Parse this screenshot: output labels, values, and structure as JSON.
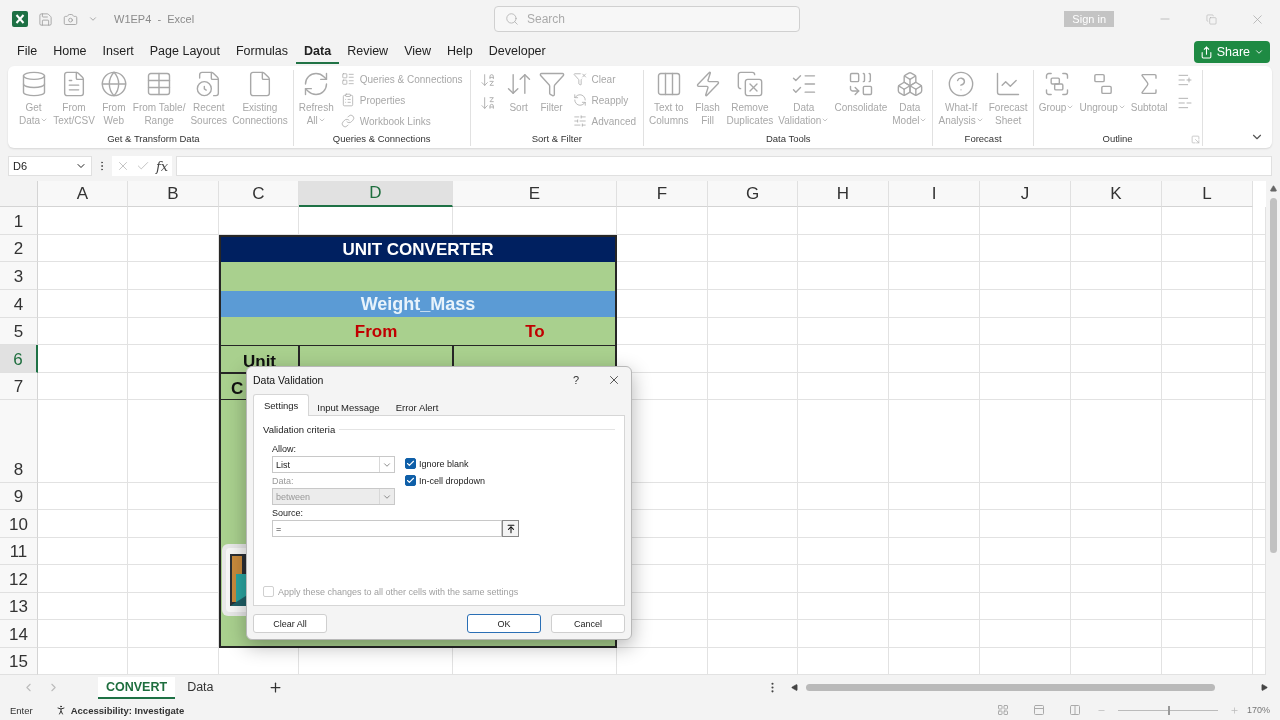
{
  "title_bar": {
    "title": "W1EP4  -  Excel",
    "search_placeholder": "Search",
    "sign_in": "Sign in"
  },
  "menu": [
    {
      "label": "File",
      "selected": false
    },
    {
      "label": "Home",
      "selected": false
    },
    {
      "label": "Insert",
      "selected": false
    },
    {
      "label": "Page Layout",
      "selected": false
    },
    {
      "label": "Formulas",
      "selected": false
    },
    {
      "label": "Data",
      "selected": true
    },
    {
      "label": "Review",
      "selected": false
    },
    {
      "label": "View",
      "selected": false
    },
    {
      "label": "Help",
      "selected": false
    },
    {
      "label": "Developer",
      "selected": false
    }
  ],
  "share": "Share",
  "ribbon": [
    {
      "name": "Get & Transform Data",
      "launcher": false,
      "items": [
        {
          "kind": "large",
          "label": "Get\nData",
          "dropdown": true
        },
        {
          "kind": "large",
          "label": "From\nText/CSV",
          "dropdown": false
        },
        {
          "kind": "large",
          "label": "From\nWeb",
          "dropdown": false
        },
        {
          "kind": "large",
          "label": "From Table/\nRange",
          "dropdown": false
        },
        {
          "kind": "large",
          "label": "Recent\nSources",
          "dropdown": false
        },
        {
          "kind": "large",
          "label": "Existing\nConnections",
          "dropdown": false
        }
      ]
    },
    {
      "name": "Queries & Connections",
      "launcher": false,
      "items": [
        {
          "kind": "large",
          "label": "Refresh\nAll",
          "dropdown": true
        },
        {
          "kind": "small",
          "label": "Queries & Connections"
        },
        {
          "kind": "small",
          "label": "Properties"
        },
        {
          "kind": "small",
          "label": "Workbook Links"
        }
      ]
    },
    {
      "name": "Sort & Filter",
      "launcher": false,
      "items": [
        {
          "kind": "icon"
        },
        {
          "kind": "icon"
        },
        {
          "kind": "large",
          "label": "Sort",
          "dropdown": false
        },
        {
          "kind": "large",
          "label": "Filter",
          "dropdown": false
        },
        {
          "kind": "small",
          "label": "Clear"
        },
        {
          "kind": "small",
          "label": "Reapply"
        },
        {
          "kind": "small",
          "label": "Advanced"
        }
      ]
    },
    {
      "name": "Data Tools",
      "launcher": false,
      "items": [
        {
          "kind": "large",
          "label": "Text to\nColumns",
          "dropdown": false
        },
        {
          "kind": "large",
          "label": "Flash\nFill",
          "dropdown": false
        },
        {
          "kind": "large",
          "label": "Remove\nDuplicates",
          "dropdown": false
        },
        {
          "kind": "large",
          "label": "Data\nValidation",
          "dropdown": true
        },
        {
          "kind": "large",
          "label": "Consolidate",
          "dropdown": false
        },
        {
          "kind": "large",
          "label": "Data\nModel",
          "dropdown": true
        }
      ]
    },
    {
      "name": "Forecast",
      "launcher": false,
      "items": [
        {
          "kind": "large",
          "label": "What-If\nAnalysis",
          "dropdown": true
        },
        {
          "kind": "large",
          "label": "Forecast\nSheet",
          "dropdown": false
        }
      ]
    },
    {
      "name": "Outline",
      "launcher": true,
      "items": [
        {
          "kind": "large",
          "label": "Group",
          "dropdown": true
        },
        {
          "kind": "large",
          "label": "Ungroup",
          "dropdown": true
        },
        {
          "kind": "large",
          "label": "Subtotal",
          "dropdown": false
        },
        {
          "kind": "icon"
        },
        {
          "kind": "icon"
        }
      ]
    }
  ],
  "formula_bar": {
    "name_box": "D6",
    "fx": "fx"
  },
  "columns": [
    {
      "label": "A",
      "selected": false
    },
    {
      "label": "B",
      "selected": false
    },
    {
      "label": "C",
      "selected": false
    },
    {
      "label": "D",
      "selected": true
    },
    {
      "label": "E",
      "selected": false
    },
    {
      "label": "F",
      "selected": false
    },
    {
      "label": "G",
      "selected": false
    },
    {
      "label": "H",
      "selected": false
    },
    {
      "label": "I",
      "selected": false
    },
    {
      "label": "J",
      "selected": false
    },
    {
      "label": "K",
      "selected": false
    },
    {
      "label": "L",
      "selected": false
    }
  ],
  "rows": [
    {
      "label": "1",
      "selected": false
    },
    {
      "label": "2",
      "selected": false
    },
    {
      "label": "3",
      "selected": false
    },
    {
      "label": "4",
      "selected": false
    },
    {
      "label": "5",
      "selected": false
    },
    {
      "label": "6",
      "selected": true
    },
    {
      "label": "7",
      "selected": false
    },
    {
      "label": "8",
      "selected": false
    },
    {
      "label": "9",
      "selected": false
    },
    {
      "label": "10",
      "selected": false
    },
    {
      "label": "11",
      "selected": false
    },
    {
      "label": "12",
      "selected": false
    },
    {
      "label": "13",
      "selected": false
    },
    {
      "label": "14",
      "selected": false
    },
    {
      "label": "15",
      "selected": false
    }
  ],
  "converter": {
    "title": "UNIT CONVERTER",
    "category": "Weight_Mass",
    "from": "From",
    "to": "To",
    "rows": [
      {
        "label": "Unit"
      },
      {
        "label": "C"
      }
    ]
  },
  "dialog": {
    "title": "Data Validation",
    "help": "?",
    "tabs": [
      {
        "label": "Settings",
        "selected": true
      },
      {
        "label": "Input Message",
        "selected": false
      },
      {
        "label": "Error Alert",
        "selected": false
      }
    ],
    "group_label": "Validation criteria",
    "allow_label": "Allow:",
    "allow_value": "List",
    "data_label": "Data:",
    "data_value": "between",
    "data_disabled": true,
    "checkboxes": [
      {
        "label": "Ignore blank",
        "checked": true
      },
      {
        "label": "In-cell dropdown",
        "checked": true
      }
    ],
    "source_label": "Source:",
    "source_value": "=",
    "apply": {
      "label": "Apply these changes to all other cells with the same settings",
      "checked": false,
      "disabled": true
    },
    "buttons": [
      {
        "label": "Clear All",
        "default": false
      },
      {
        "label": "OK",
        "default": true
      },
      {
        "label": "Cancel",
        "default": false
      }
    ]
  },
  "sheet_tabs": [
    {
      "label": "CONVERT",
      "selected": true
    },
    {
      "label": "Data",
      "selected": false
    }
  ],
  "status_bar": {
    "mode": "Enter",
    "accessibility": "Accessibility: Investigate",
    "zoom_slider": {
      "level": 0.5
    },
    "zoom": "170%"
  }
}
